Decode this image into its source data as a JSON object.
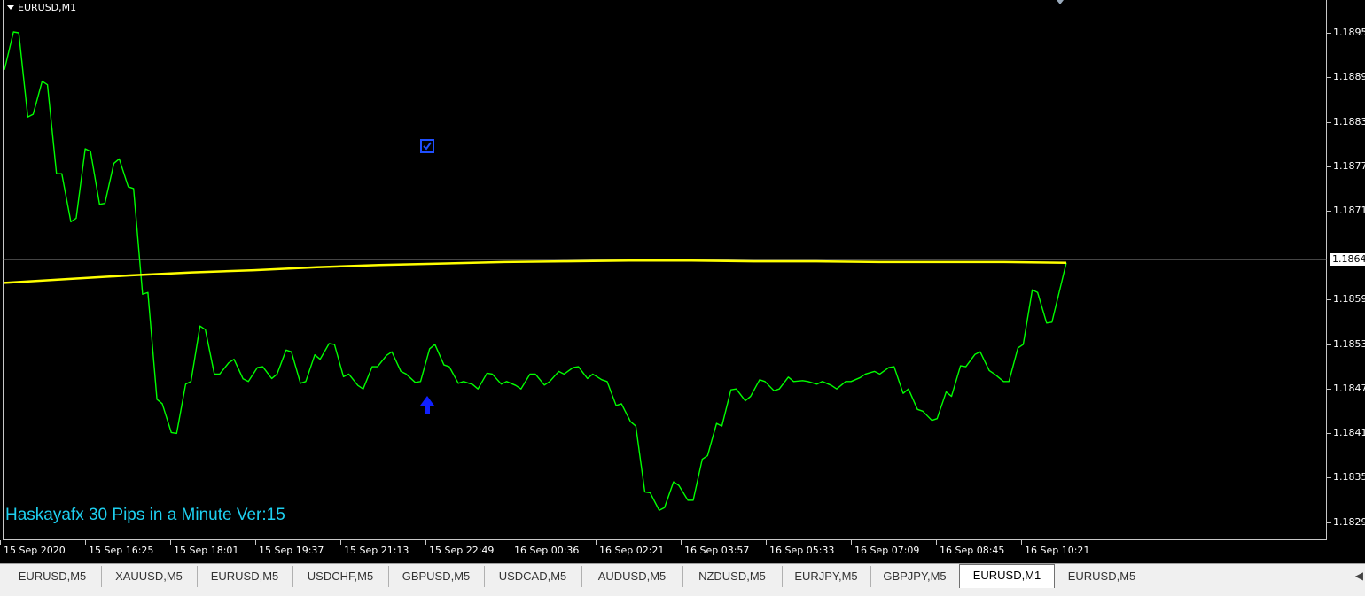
{
  "window": {
    "symbol": "EURUSD,M1"
  },
  "indicator": {
    "title": "Haskayafx 30 Pips in a Minute Ver:15"
  },
  "price_axis": {
    "ticks": [
      "1.1895",
      "1.1889",
      "1.1883",
      "1.1877",
      "1.1871",
      "1.1859",
      "1.1853",
      "1.1847",
      "1.1841",
      "1.1835",
      "1.1829"
    ],
    "current": "1.1864"
  },
  "time_axis": {
    "ticks": [
      "15 Sep 2020",
      "15 Sep 16:25",
      "15 Sep 18:01",
      "15 Sep 19:37",
      "15 Sep 21:13",
      "15 Sep 22:49",
      "16 Sep 00:36",
      "16 Sep 02:21",
      "16 Sep 03:57",
      "16 Sep 05:33",
      "16 Sep 07:09",
      "16 Sep 08:45",
      "16 Sep 10:21"
    ]
  },
  "colors": {
    "price_line": "#00ff00",
    "moving_average": "#ffff00",
    "signal": "#0000ff",
    "indicator_text": "#1ed0f0",
    "background": "#000000"
  },
  "chart_data": {
    "type": "line",
    "title": "",
    "ylim": [
      1.1826,
      1.1898
    ],
    "series": [
      {
        "values": [
          1.189,
          1.1895,
          1.1884,
          1.1888,
          1.1876,
          1.187,
          1.1879,
          1.1872,
          1.1878,
          1.1874,
          1.186,
          1.1845,
          1.1841,
          1.1848,
          1.1855,
          1.1849,
          1.1851,
          1.1848,
          1.185,
          1.1849,
          1.1852,
          1.1848,
          1.1851,
          1.1853,
          1.1849,
          1.1847,
          1.185,
          1.1852,
          1.1849,
          1.1848,
          1.1853,
          1.185,
          1.1848,
          1.1847,
          1.1849,
          1.1848,
          1.1847,
          1.1849,
          1.1848,
          1.1849,
          1.185,
          1.1849,
          1.1848,
          1.1845,
          1.1842,
          1.1833,
          1.1831,
          1.1834,
          1.1832,
          1.1838,
          1.1842,
          1.1847,
          1.1846,
          1.1848,
          1.1847,
          1.1848,
          1.1848,
          1.1848,
          1.1847,
          1.1848,
          1.1849,
          1.1849,
          1.185,
          1.1847,
          1.1844,
          1.1843,
          1.1846,
          1.185,
          1.1852,
          1.1849,
          1.1848,
          1.1853,
          1.186,
          1.1856,
          1.1864
        ]
      },
      {
        "values": [
          1.18613,
          1.18618,
          1.18623,
          1.18627,
          1.1863,
          1.18634,
          1.18637,
          1.18639,
          1.18641,
          1.18642,
          1.18643,
          1.18643,
          1.18642,
          1.18642,
          1.18641,
          1.18641,
          1.18641,
          1.1864
        ]
      }
    ]
  }
}
